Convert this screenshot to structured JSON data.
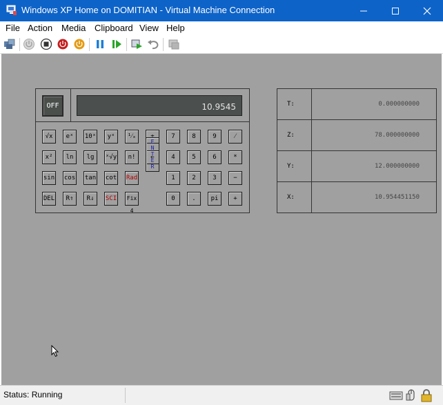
{
  "window": {
    "title": "Windows XP Home on DOMITIAN - Virtual Machine Connection",
    "controls": [
      "minimize",
      "maximize",
      "close"
    ]
  },
  "menu": [
    "File",
    "Action",
    "Media",
    "Clipboard",
    "View",
    "Help"
  ],
  "toolbar": {
    "buttons": [
      "ctrl-alt-del-icon",
      "start-icon",
      "turn-off-icon",
      "shut-down-icon",
      "save-state-icon",
      "pause-icon",
      "resume-icon",
      "checkpoint-icon",
      "revert-icon",
      "enhanced-session-icon"
    ]
  },
  "calculator": {
    "power_label": "OFF",
    "display": "10.9545",
    "keys": [
      [
        "√x",
        "eˣ",
        "10ˣ",
        "yˣ",
        "¹⁄ₓ",
        "±",
        "7",
        "8",
        "9",
        "⁄"
      ],
      [
        "x²",
        "ln",
        "lg",
        "ˣ√y",
        "n!",
        "←",
        "4",
        "5",
        "6",
        "*"
      ],
      [
        "sin",
        "cos",
        "tan",
        "cot",
        "Rad",
        "ENTER",
        "1",
        "2",
        "3",
        "−"
      ],
      [
        "DEL",
        "R⇑",
        "R⇓",
        "SCI",
        "Fix 4",
        "ENTER",
        "0",
        ".",
        "pi",
        "+"
      ]
    ],
    "enter_label": "ENTER"
  },
  "stack": [
    {
      "reg": "T:",
      "value": "0.000000000"
    },
    {
      "reg": "Z:",
      "value": "78.000000000"
    },
    {
      "reg": "Y:",
      "value": "12.000000000"
    },
    {
      "reg": "X:",
      "value": "10.954451150"
    }
  ],
  "status": {
    "text": "Status: Running",
    "icons": [
      "keyboard-icon",
      "mouse-icon",
      "lock-icon"
    ]
  },
  "colors": {
    "title_bar": "#0d63c8",
    "vm_background": "#a0a0a0",
    "lcd": "#4b4f4d",
    "red_key": "#b00000",
    "enter_key": "#1a1aa8"
  }
}
